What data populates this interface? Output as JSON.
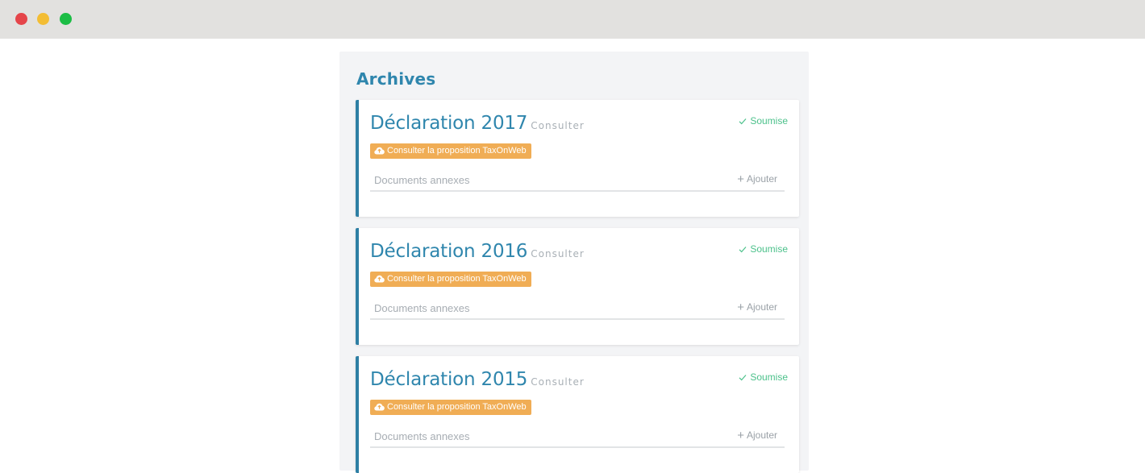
{
  "window": {
    "controls": [
      "close",
      "minimize",
      "maximize"
    ]
  },
  "archives": {
    "title": "Archives",
    "items": [
      {
        "title": "Déclaration 2017",
        "consult_label": "Consulter",
        "status": "Soumise",
        "proposal_label": "Consulter la proposition TaxOnWeb",
        "documents_label": "Documents annexes",
        "add_label": "Ajouter"
      },
      {
        "title": "Déclaration 2016",
        "consult_label": "Consulter",
        "status": "Soumise",
        "proposal_label": "Consulter la proposition TaxOnWeb",
        "documents_label": "Documents annexes",
        "add_label": "Ajouter"
      },
      {
        "title": "Déclaration 2015",
        "consult_label": "Consulter",
        "status": "Soumise",
        "proposal_label": "Consulter la proposition TaxOnWeb",
        "documents_label": "Documents annexes",
        "add_label": "Ajouter"
      }
    ]
  },
  "colors": {
    "accent": "#2f86ad",
    "status_ok": "#4cc18b",
    "proposal_button": "#f0ad55"
  },
  "icons": {
    "status": "check-icon",
    "proposal": "cloud-icon",
    "add": "plus-icon"
  }
}
